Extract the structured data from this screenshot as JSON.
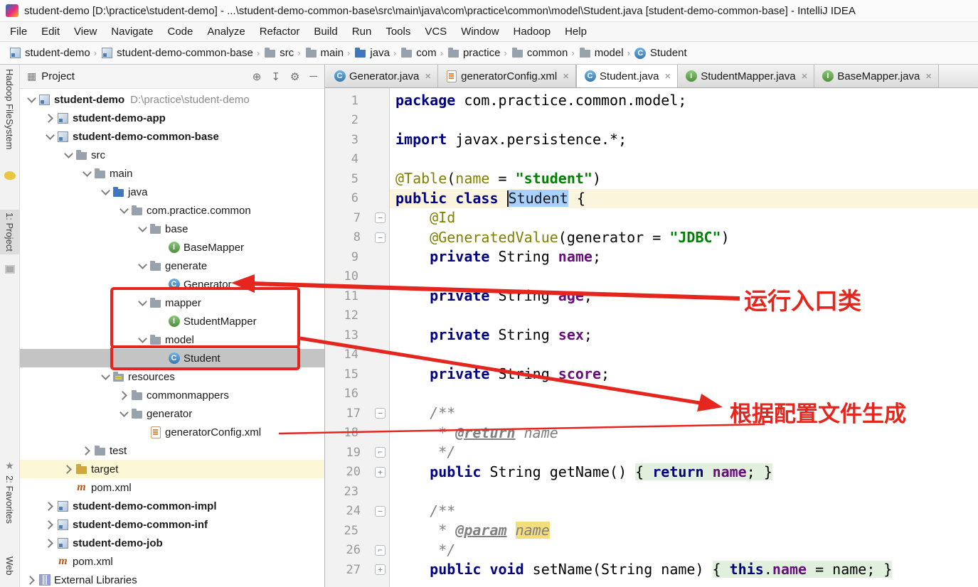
{
  "window": {
    "title": "student-demo [D:\\practice\\student-demo] - ...\\student-demo-common-base\\src\\main\\java\\com\\practice\\common\\model\\Student.java [student-demo-common-base] - IntelliJ IDEA"
  },
  "menu_bar": {
    "items": [
      "File",
      "Edit",
      "View",
      "Navigate",
      "Code",
      "Analyze",
      "Refactor",
      "Build",
      "Run",
      "Tools",
      "VCS",
      "Window",
      "Hadoop",
      "Help"
    ]
  },
  "breadcrumbs": [
    {
      "label": "student-demo",
      "icon": "module"
    },
    {
      "label": "student-demo-common-base",
      "icon": "module"
    },
    {
      "label": "src",
      "icon": "folder"
    },
    {
      "label": "main",
      "icon": "folder"
    },
    {
      "label": "java",
      "icon": "folder-blue"
    },
    {
      "label": "com",
      "icon": "folder"
    },
    {
      "label": "practice",
      "icon": "folder"
    },
    {
      "label": "common",
      "icon": "folder"
    },
    {
      "label": "model",
      "icon": "folder"
    },
    {
      "label": "Student",
      "icon": "class"
    }
  ],
  "tool_strip": {
    "hadoop_label": "Hadoop FileSystem",
    "project_label": "1: Project",
    "favorites_label": "2: Favorites",
    "web_label": "Web"
  },
  "project_panel": {
    "title": "Project",
    "header_actions": [
      "locate",
      "collapse-all",
      "settings",
      "hide"
    ],
    "tree": [
      {
        "label": "student-demo",
        "extra": "D:\\practice\\student-demo",
        "lvl": 0,
        "chev": "e",
        "icon": "module",
        "bold": true
      },
      {
        "label": "student-demo-app",
        "lvl": 1,
        "chev": "c",
        "icon": "module",
        "bold": true
      },
      {
        "label": "student-demo-common-base",
        "lvl": 1,
        "chev": "e",
        "icon": "module",
        "bold": true
      },
      {
        "label": "src",
        "lvl": 2,
        "chev": "e",
        "icon": "folder"
      },
      {
        "label": "main",
        "lvl": 3,
        "chev": "e",
        "icon": "folder"
      },
      {
        "label": "java",
        "lvl": 4,
        "chev": "e",
        "icon": "folder-blue"
      },
      {
        "label": "com.practice.common",
        "lvl": 5,
        "chev": "e",
        "icon": "folder"
      },
      {
        "label": "base",
        "lvl": 6,
        "chev": "e",
        "icon": "folder"
      },
      {
        "label": "BaseMapper",
        "lvl": 7,
        "chev": "n",
        "icon": "interface"
      },
      {
        "label": "generate",
        "lvl": 6,
        "chev": "e",
        "icon": "folder"
      },
      {
        "label": "Generator",
        "lvl": 7,
        "chev": "n",
        "icon": "class"
      },
      {
        "label": "mapper",
        "lvl": 6,
        "chev": "e",
        "icon": "folder"
      },
      {
        "label": "StudentMapper",
        "lvl": 7,
        "chev": "n",
        "icon": "interface"
      },
      {
        "label": "model",
        "lvl": 6,
        "chev": "e",
        "icon": "folder"
      },
      {
        "label": "Student",
        "lvl": 7,
        "chev": "n",
        "icon": "class",
        "sel": true
      },
      {
        "label": "resources",
        "lvl": 4,
        "chev": "e",
        "icon": "folder-res"
      },
      {
        "label": "commonmappers",
        "lvl": 5,
        "chev": "c",
        "icon": "folder"
      },
      {
        "label": "generator",
        "lvl": 5,
        "chev": "e",
        "icon": "folder"
      },
      {
        "label": "generatorConfig.xml",
        "lvl": 6,
        "chev": "n",
        "icon": "xml"
      },
      {
        "label": "test",
        "lvl": 3,
        "chev": "c",
        "icon": "folder"
      },
      {
        "label": "target",
        "lvl": 2,
        "chev": "c",
        "icon": "folder-gold",
        "hl": true
      },
      {
        "label": "pom.xml",
        "lvl": 2,
        "chev": "n",
        "icon": "maven"
      },
      {
        "label": "student-demo-common-impl",
        "lvl": 1,
        "chev": "c",
        "icon": "module",
        "bold": true
      },
      {
        "label": "student-demo-common-inf",
        "lvl": 1,
        "chev": "c",
        "icon": "module",
        "bold": true
      },
      {
        "label": "student-demo-job",
        "lvl": 1,
        "chev": "c",
        "icon": "module",
        "bold": true
      },
      {
        "label": "pom.xml",
        "lvl": 1,
        "chev": "n",
        "icon": "maven"
      },
      {
        "label": "External Libraries",
        "lvl": 0,
        "chev": "c",
        "icon": "lib"
      }
    ]
  },
  "editor": {
    "tabs": [
      {
        "label": "Generator.java",
        "icon": "class",
        "active": false
      },
      {
        "label": "generatorConfig.xml",
        "icon": "xml",
        "active": false
      },
      {
        "label": "Student.java",
        "icon": "class",
        "active": true
      },
      {
        "label": "StudentMapper.java",
        "icon": "interface",
        "active": false
      },
      {
        "label": "BaseMapper.java",
        "icon": "interface",
        "active": false
      }
    ],
    "lines": [
      {
        "n": "1",
        "seg": [
          [
            "k",
            "package "
          ],
          [
            "p",
            "com.practice.common.model;"
          ]
        ]
      },
      {
        "n": "2",
        "seg": []
      },
      {
        "n": "3",
        "seg": [
          [
            "k",
            "import "
          ],
          [
            "p",
            "javax.persistence.*;"
          ]
        ]
      },
      {
        "n": "4",
        "seg": []
      },
      {
        "n": "5",
        "seg": [
          [
            "a",
            "@Table"
          ],
          [
            "p",
            "("
          ],
          [
            "a",
            "name"
          ],
          [
            "p",
            " = "
          ],
          [
            "s",
            "\"student\""
          ],
          [
            "p",
            ")"
          ]
        ]
      },
      {
        "n": "6",
        "cur": true,
        "seg": [
          [
            "k",
            "public class "
          ],
          [
            "caret",
            ""
          ],
          [
            "sel",
            "Student"
          ],
          [
            "p",
            " {"
          ]
        ]
      },
      {
        "n": "7",
        "fm": "start",
        "seg": [
          [
            "p",
            "    "
          ],
          [
            "a",
            "@Id"
          ]
        ]
      },
      {
        "n": "8",
        "fm": "start",
        "seg": [
          [
            "p",
            "    "
          ],
          [
            "a",
            "@GeneratedValue"
          ],
          [
            "p",
            "(generator = "
          ],
          [
            "s",
            "\"JDBC\""
          ],
          [
            "p",
            ")"
          ]
        ]
      },
      {
        "n": "9",
        "seg": [
          [
            "p",
            "    "
          ],
          [
            "k",
            "private "
          ],
          [
            "p",
            "String "
          ],
          [
            "f",
            "name"
          ],
          [
            "p",
            ";"
          ]
        ]
      },
      {
        "n": "10",
        "seg": []
      },
      {
        "n": "11",
        "seg": [
          [
            "p",
            "    "
          ],
          [
            "k",
            "private "
          ],
          [
            "p",
            "String "
          ],
          [
            "f",
            "age"
          ],
          [
            "p",
            ";"
          ]
        ]
      },
      {
        "n": "12",
        "seg": []
      },
      {
        "n": "13",
        "seg": [
          [
            "p",
            "    "
          ],
          [
            "k",
            "private "
          ],
          [
            "p",
            "String "
          ],
          [
            "f",
            "sex"
          ],
          [
            "p",
            ";"
          ]
        ]
      },
      {
        "n": "14",
        "seg": []
      },
      {
        "n": "15",
        "seg": [
          [
            "p",
            "    "
          ],
          [
            "k",
            "private "
          ],
          [
            "p",
            "String "
          ],
          [
            "f",
            "score"
          ],
          [
            "p",
            ";"
          ]
        ]
      },
      {
        "n": "16",
        "seg": []
      },
      {
        "n": "17",
        "fm": "start",
        "seg": [
          [
            "c",
            "    /**"
          ]
        ]
      },
      {
        "n": "18",
        "seg": [
          [
            "c",
            "     * "
          ],
          [
            "ct",
            "@return"
          ],
          [
            "c",
            " name"
          ]
        ]
      },
      {
        "n": "19",
        "fm": "end",
        "seg": [
          [
            "c",
            "     */"
          ]
        ]
      },
      {
        "n": "20",
        "fm": "plus",
        "seg": [
          [
            "p",
            "    "
          ],
          [
            "k",
            "public "
          ],
          [
            "p",
            "String getName() "
          ],
          [
            "fold p",
            "{ "
          ],
          [
            "fold k",
            "return "
          ],
          [
            "fold f",
            "name"
          ],
          [
            "fold p",
            "; }"
          ]
        ]
      },
      {
        "n": "23",
        "seg": []
      },
      {
        "n": "24",
        "fm": "start",
        "seg": [
          [
            "c",
            "    /**"
          ]
        ]
      },
      {
        "n": "25",
        "seg": [
          [
            "c",
            "     * "
          ],
          [
            "ct",
            "@param"
          ],
          [
            "c",
            " "
          ],
          [
            "hl",
            "name"
          ]
        ]
      },
      {
        "n": "26",
        "fm": "end",
        "seg": [
          [
            "c",
            "     */"
          ]
        ]
      },
      {
        "n": "27",
        "fm": "plus",
        "seg": [
          [
            "p",
            "    "
          ],
          [
            "k",
            "public void "
          ],
          [
            "p",
            "setName(String name) "
          ],
          [
            "fold p",
            "{ "
          ],
          [
            "fold k",
            "this"
          ],
          [
            "fold p",
            "."
          ],
          [
            "fold f",
            "name"
          ],
          [
            "fold p",
            " = name; }"
          ]
        ]
      }
    ]
  },
  "annotations": {
    "color": "#E5261F",
    "entry_label": "运行入口类",
    "generate_label": "根据配置文件生成"
  }
}
